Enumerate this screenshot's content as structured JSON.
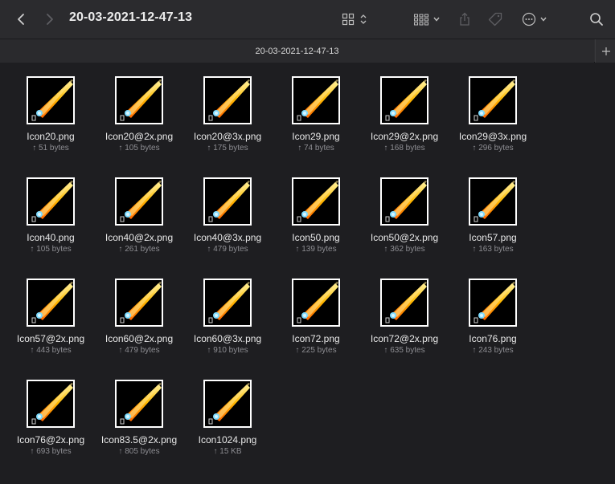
{
  "window": {
    "title": "20-03-2021-12-47-13",
    "tab_label": "20-03-2021-12-47-13"
  },
  "toolbar": {
    "icons": [
      "chevron-left-icon",
      "chevron-right-icon",
      "view-grid-icon",
      "group-icon",
      "share-icon",
      "tag-icon",
      "more-icon",
      "search-icon"
    ]
  },
  "files": [
    {
      "name": "Icon20.png",
      "size": "↑ 51 bytes"
    },
    {
      "name": "Icon20@2x.png",
      "size": "↑ 105 bytes"
    },
    {
      "name": "Icon20@3x.png",
      "size": "↑ 175 bytes"
    },
    {
      "name": "Icon29.png",
      "size": "↑ 74 bytes"
    },
    {
      "name": "Icon29@2x.png",
      "size": "↑ 168 bytes"
    },
    {
      "name": "Icon29@3x.png",
      "size": "↑ 296 bytes"
    },
    {
      "name": "Icon40.png",
      "size": "↑ 105 bytes"
    },
    {
      "name": "Icon40@2x.png",
      "size": "↑ 261 bytes"
    },
    {
      "name": "Icon40@3x.png",
      "size": "↑ 479 bytes"
    },
    {
      "name": "Icon50.png",
      "size": "↑ 139 bytes"
    },
    {
      "name": "Icon50@2x.png",
      "size": "↑ 362 bytes"
    },
    {
      "name": "Icon57.png",
      "size": "↑ 163 bytes"
    },
    {
      "name": "Icon57@2x.png",
      "size": "↑ 443 bytes"
    },
    {
      "name": "Icon60@2x.png",
      "size": "↑ 479 bytes"
    },
    {
      "name": "Icon60@3x.png",
      "size": "↑ 910 bytes"
    },
    {
      "name": "Icon72.png",
      "size": "↑ 225 bytes"
    },
    {
      "name": "Icon72@2x.png",
      "size": "↑ 635 bytes"
    },
    {
      "name": "Icon76.png",
      "size": "↑ 243 bytes"
    },
    {
      "name": "Icon76@2x.png",
      "size": "↑ 693 bytes"
    },
    {
      "name": "Icon83.5@2x.png",
      "size": "↑ 805 bytes"
    },
    {
      "name": "Icon1024.png",
      "size": "↑ 15 KB"
    }
  ]
}
